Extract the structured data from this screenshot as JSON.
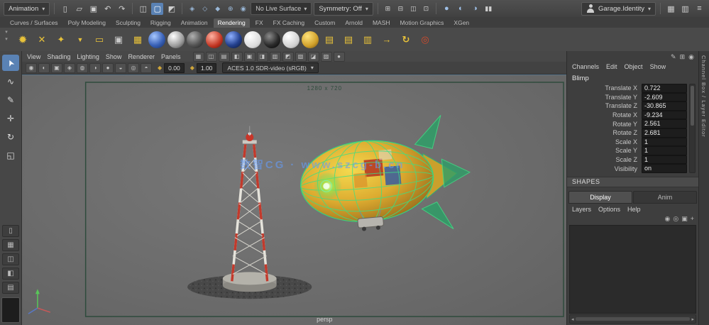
{
  "colors": {
    "accent": "#5a82b4",
    "viewport_bg": "#6e6e6e",
    "camera_gate": "#2e4b3c",
    "wireframe_green": "#3ce084",
    "blimp_yellow": "#ddab30",
    "tower_red": "#c23a2c",
    "watermark_blue": "#649bf5"
  },
  "glyphs": {
    "caret": "▾"
  },
  "topbar": {
    "mode": "Animation",
    "file_glyphs": [
      "▯",
      "▱",
      "▣"
    ],
    "undo_glyph": "↶",
    "redo_glyph": "↷",
    "select_glyphs": [
      "◫",
      "▢",
      "◩"
    ],
    "snap_glyphs": [
      "◈",
      "◇",
      "◆",
      "⊕",
      "◉"
    ],
    "live_surface": "No Live Surface",
    "symmetry": "Symmetry: Off",
    "panel_glyphs": [
      "⊞",
      "⊟",
      "◫",
      "⊡"
    ],
    "render_glyphs": [
      "●",
      "◐",
      "◑"
    ],
    "pause_glyph": "▮▮",
    "account": "Garage.Identity",
    "right_glyphs": [
      "▦",
      "▥",
      "≡"
    ]
  },
  "shelf": {
    "tabs": [
      "Curves / Surfaces",
      "Poly Modeling",
      "Sculpting",
      "Rigging",
      "Animation",
      "Rendering",
      "FX",
      "FX Caching",
      "Custom",
      "Arnold",
      "MASH",
      "Motion Graphics",
      "XGen"
    ],
    "active_tab": "Rendering",
    "ctrl_glyphs": [
      "▾",
      "▾"
    ],
    "icons": [
      {
        "glyph": "✹",
        "style": "color:#e8c23a;font-size:15px"
      },
      {
        "glyph": "✕",
        "style": "color:#e8c23a"
      },
      {
        "glyph": "✦",
        "style": "color:#e8c23a"
      },
      {
        "glyph": "▼",
        "style": "color:#e8c23a;font-size:9px"
      },
      {
        "glyph": "▭",
        "style": "color:#e8c23a"
      },
      {
        "glyph": "▣",
        "style": "color:#c8c8c8"
      },
      {
        "glyph": "▦",
        "style": "color:#e8c23a"
      },
      {
        "glyph": "",
        "style": "background:radial-gradient(circle at 35% 30%, #a8c8ff, #3a62b8 55%, #102a60);border-radius:50%"
      },
      {
        "glyph": "",
        "style": "background:radial-gradient(circle at 35% 30%, #ffffff, #9a9a9a 60%, #3a3a3a);border-radius:50%"
      },
      {
        "glyph": "",
        "style": "background:radial-gradient(circle at 35% 30%, #b0b0b0, #555555 55%, #1a1a1a);border-radius:50%"
      },
      {
        "glyph": "",
        "style": "background:radial-gradient(circle at 35% 30%, #ffb3a3, #c23522 60%, #5a1008);border-radius:50%"
      },
      {
        "glyph": "",
        "style": "background:radial-gradient(circle at 35% 30%, #8fb0ff, #24418f 55%, #0a1430);border-radius:50%"
      },
      {
        "glyph": "",
        "style": "background:radial-gradient(circle at 35% 30%, #ffffff, #dadada 65%, #8a8a8a);border-radius:50%"
      },
      {
        "glyph": "",
        "style": "background:radial-gradient(circle at 35% 30%, #8a8a8a, #2c2c2c 55%, #000000);border-radius:50%"
      },
      {
        "glyph": "",
        "style": "background:radial-gradient(circle at 35% 30%, #ffffff, #d0d0d0 65%, #808080);border-radius:50%"
      },
      {
        "glyph": "",
        "style": "background:radial-gradient(circle at 35% 30%, #ffe27a, #d0a02a 60%, #6a4a10);border-radius:50%"
      },
      {
        "glyph": "▤",
        "style": "color:#e8c23a"
      },
      {
        "glyph": "▤",
        "style": "color:#e8c23a"
      },
      {
        "glyph": "▥",
        "style": "color:#e8c23a"
      },
      {
        "glyph": "→",
        "style": "color:#e8c23a;font-weight:bold"
      },
      {
        "glyph": "↻",
        "style": "color:#e8c23a;font-weight:bold"
      },
      {
        "glyph": "◎",
        "style": "color:#d84a2a;font-weight:bold"
      }
    ]
  },
  "toolbox": {
    "tool_glyphs": [
      "➤",
      "∿",
      "✎",
      "✛",
      "↻",
      "◱"
    ],
    "layout_glyphs": [
      "▯",
      "▦",
      "◫",
      "◧",
      "▤"
    ]
  },
  "viewport": {
    "menus": [
      "View",
      "Shading",
      "Lighting",
      "Show",
      "Renderer",
      "Panels"
    ],
    "menu_icons": [
      "▦",
      "◫",
      "▤",
      "◧",
      "▣",
      "◨",
      "▥",
      "◩",
      "▧",
      "◪",
      "▨",
      "●"
    ],
    "toolbar_icons": [
      "◉",
      "◐",
      "▣",
      "◈",
      "◍",
      "◑",
      "●",
      "◒",
      "◎",
      "◓"
    ],
    "exposure": {
      "icon": "◆",
      "value": "0.00"
    },
    "gamma": {
      "icon": "◆",
      "value": "1.00"
    },
    "colorspace": "ACES 1.0 SDR-video (sRGB)",
    "resolution_label": "1280 x 720",
    "camera_label": "persp",
    "watermark": "数智CG · www.szcg-b.cn"
  },
  "channelbox": {
    "top_icons": [
      "✎",
      "⊞",
      "◉"
    ],
    "menus": [
      "Channels",
      "Edit",
      "Object",
      "Show"
    ],
    "object_name": "Blimp",
    "rows": [
      {
        "label": "Translate X",
        "value": "0.722"
      },
      {
        "label": "Translate Y",
        "value": "-2.609"
      },
      {
        "label": "Translate Z",
        "value": "-30.865"
      },
      {
        "label": "Rotate X",
        "value": "-9.234"
      },
      {
        "label": "Rotate Y",
        "value": "2.561"
      },
      {
        "label": "Rotate Z",
        "value": "2.681"
      },
      {
        "label": "Scale X",
        "value": "1"
      },
      {
        "label": "Scale Y",
        "value": "1"
      },
      {
        "label": "Scale Z",
        "value": "1"
      },
      {
        "label": "Visibility",
        "value": "on"
      }
    ],
    "shapes_header": "SHAPES"
  },
  "layers": {
    "tabs": [
      "Display",
      "Anim"
    ],
    "menus": [
      "Layers",
      "Options",
      "Help"
    ],
    "icons": [
      "◉",
      "◎",
      "▣",
      "+"
    ]
  },
  "scrollbar": {
    "left": "◂",
    "right": "▸"
  },
  "right_strip": {
    "label": "Channel Box / Layer Editor"
  }
}
